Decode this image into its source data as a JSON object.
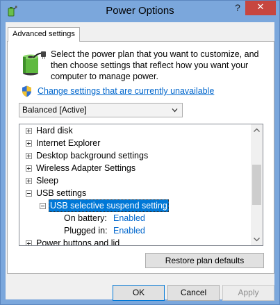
{
  "window": {
    "title": "Power Options",
    "help_label": "?",
    "close_label": "✕"
  },
  "tabs": [
    {
      "label": "Advanced settings",
      "selected": true
    }
  ],
  "intro": {
    "text": "Select the power plan that you want to customize, and then choose settings that reflect how you want your computer to manage power."
  },
  "change_link": "Change settings that are currently unavailable",
  "plan_select": {
    "value": "Balanced [Active]"
  },
  "tree": {
    "items": [
      {
        "label": "Hard disk",
        "expander": "plus"
      },
      {
        "label": "Internet Explorer",
        "expander": "plus"
      },
      {
        "label": "Desktop background settings",
        "expander": "plus"
      },
      {
        "label": "Wireless Adapter Settings",
        "expander": "plus"
      },
      {
        "label": "Sleep",
        "expander": "plus"
      },
      {
        "label": "USB settings",
        "expander": "minus"
      },
      {
        "label": "USB selective suspend setting",
        "expander": "minus",
        "selected": true
      },
      {
        "label": "Power buttons and lid",
        "expander": "plus"
      }
    ],
    "values": [
      {
        "label": "On battery:",
        "value": "Enabled"
      },
      {
        "label": "Plugged in:",
        "value": "Enabled"
      }
    ]
  },
  "restore_button": "Restore plan defaults",
  "buttons": {
    "ok": "OK",
    "cancel": "Cancel",
    "apply": "Apply"
  },
  "colors": {
    "title_bar": "#7ba7dc",
    "close_button": "#c7463f",
    "selection": "#0078d7",
    "link": "#0066cc",
    "disabled_text": "#8d8d8d"
  },
  "icons": {
    "app": "battery-plug-icon",
    "intro": "battery-plug-icon",
    "uac": "shield-icon",
    "dropdown": "chevron-down-icon"
  }
}
